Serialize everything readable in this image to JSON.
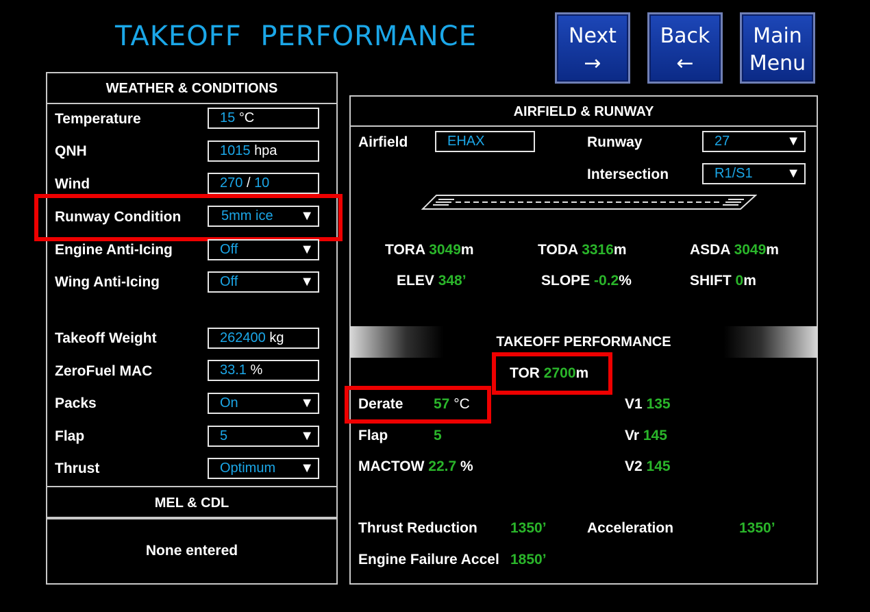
{
  "title": "TAKEOFF  PERFORMANCE",
  "nav": {
    "next": {
      "label": "Next",
      "arrow": "→"
    },
    "back": {
      "label": "Back",
      "arrow": "←"
    },
    "main": {
      "line1": "Main",
      "line2": "Menu"
    }
  },
  "weather": {
    "header": "WEATHER & CONDITIONS",
    "temperature": {
      "label": "Temperature",
      "value": "15",
      "unit": "°C"
    },
    "qnh": {
      "label": "QNH",
      "value": "1015",
      "unit": "hpa"
    },
    "wind": {
      "label": "Wind",
      "dir": "270",
      "sep": "/",
      "speed": "10"
    },
    "runway_condition": {
      "label": "Runway Condition",
      "value": "5mm ice"
    },
    "engine_anti_icing": {
      "label": "Engine Anti-Icing",
      "value": "Off"
    },
    "wing_anti_icing": {
      "label": "Wing Anti-Icing",
      "value": "Off"
    },
    "takeoff_weight": {
      "label": "Takeoff Weight",
      "value": "262400",
      "unit": "kg"
    },
    "zerofuel_mac": {
      "label": "ZeroFuel MAC",
      "value": "33.1",
      "unit": "%"
    },
    "packs": {
      "label": "Packs",
      "value": "On"
    },
    "flap": {
      "label": "Flap",
      "value": "5"
    },
    "thrust": {
      "label": "Thrust",
      "value": "Optimum"
    }
  },
  "mel": {
    "header": "MEL & CDL",
    "content": "None entered"
  },
  "airfield": {
    "header": "AIRFIELD & RUNWAY",
    "airfield_label": "Airfield",
    "airfield_value": "EHAX",
    "runway_label": "Runway",
    "runway_value": "27",
    "intersection_label": "Intersection",
    "intersection_value": "R1/S1",
    "tora": {
      "label": "TORA",
      "value": "3049",
      "unit": "m"
    },
    "toda": {
      "label": "TODA",
      "value": "3316",
      "unit": "m"
    },
    "asda": {
      "label": "ASDA",
      "value": "3049",
      "unit": "m"
    },
    "elev": {
      "label": "ELEV",
      "value": "348",
      "unit": "’"
    },
    "slope": {
      "label": "SLOPE",
      "value": "-0.2",
      "unit": "%"
    },
    "shift": {
      "label": "SHIFT",
      "value": "0",
      "unit": "m"
    }
  },
  "perf": {
    "header": "TAKEOFF PERFORMANCE",
    "tor": {
      "label": "TOR",
      "value": "2700",
      "unit": "m"
    },
    "derate": {
      "label": "Derate",
      "value": "57",
      "unit": "°C"
    },
    "flap": {
      "label": "Flap",
      "value": "5"
    },
    "mactow": {
      "label": "MACTOW",
      "value": "22.7",
      "unit": "%"
    },
    "v1": {
      "label": "V1",
      "value": "135"
    },
    "vr": {
      "label": "Vr",
      "value": "145"
    },
    "v2": {
      "label": "V2",
      "value": "145"
    },
    "thrust_reduction": {
      "label": "Thrust Reduction",
      "value": "1350",
      "unit": "’"
    },
    "acceleration": {
      "label": "Acceleration",
      "value": "1350",
      "unit": "’"
    },
    "engine_failure_accel": {
      "label": "Engine Failure Accel",
      "value": "1850",
      "unit": "’"
    }
  },
  "colors": {
    "accent": "#1ba7e8",
    "value_green": "#2ab52a",
    "highlight_red": "#ee0000",
    "button_blue": "#1d47b8"
  }
}
